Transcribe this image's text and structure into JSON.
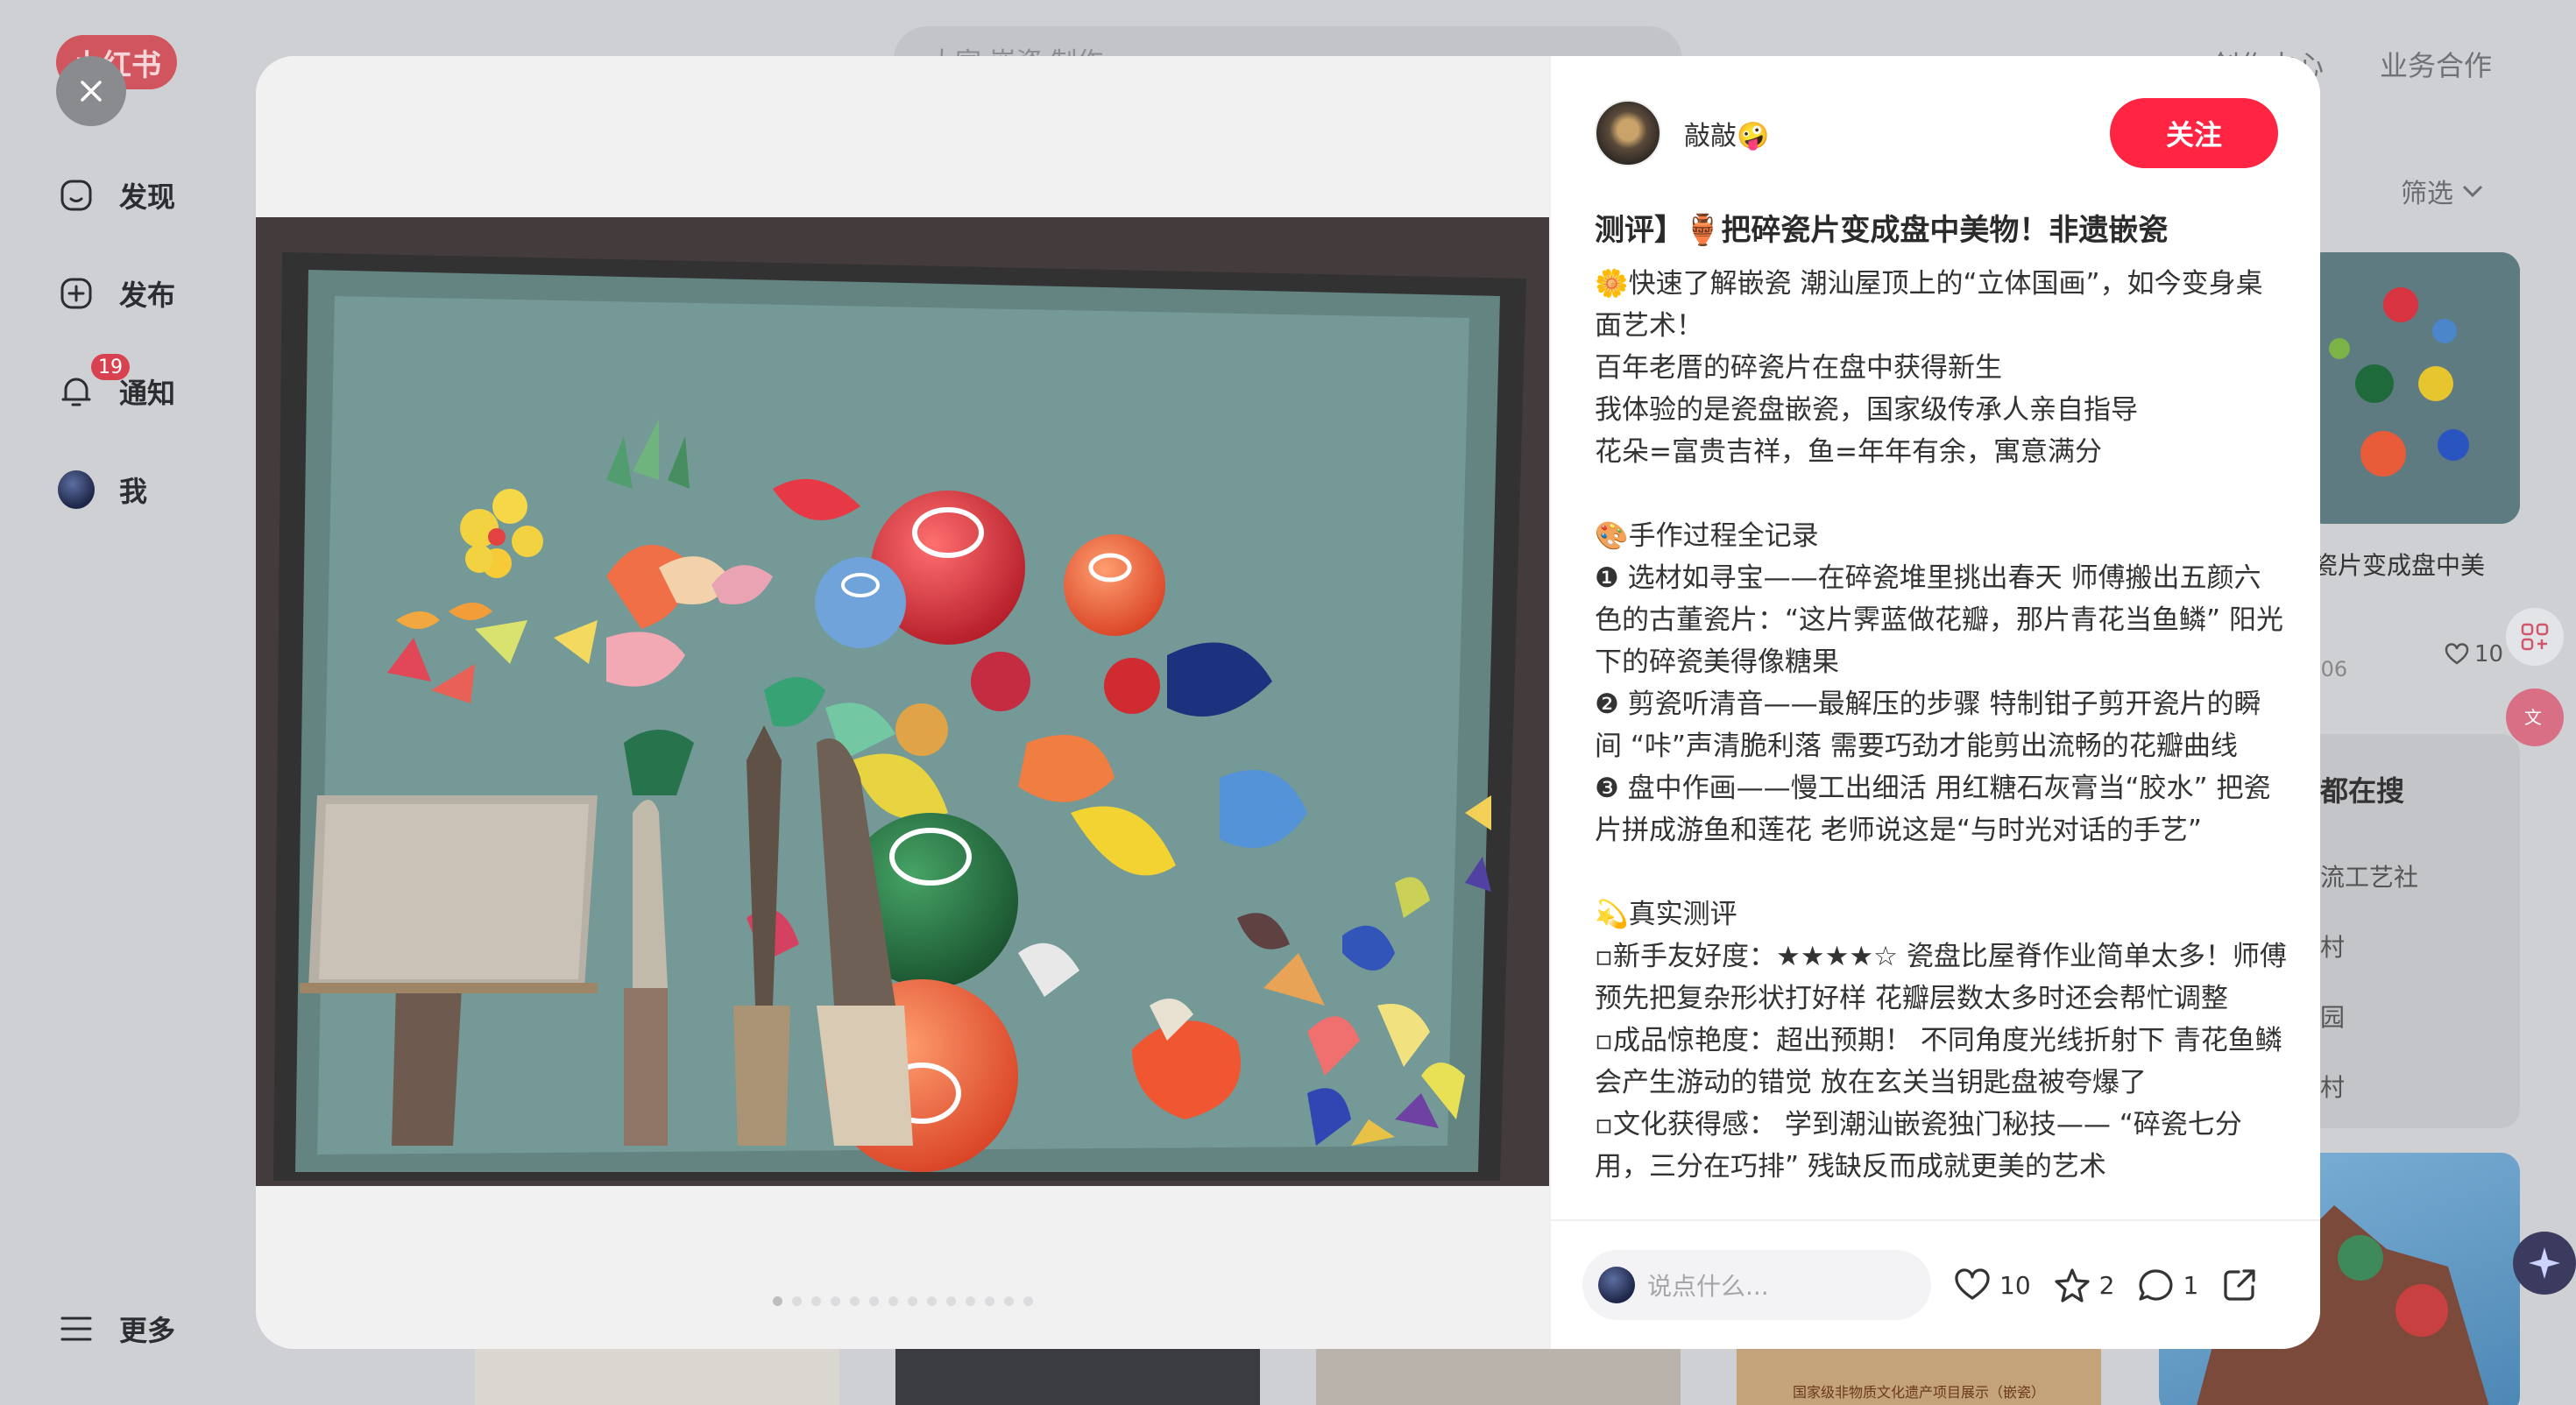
{
  "background": {
    "logo": "小红书",
    "search_text": "大家 嵌瓷 制作",
    "top_links": [
      "创作中心",
      "业务合作"
    ],
    "sidebar": [
      {
        "label": "发现",
        "icon": "home-icon"
      },
      {
        "label": "发布",
        "icon": "plus-square-icon"
      },
      {
        "label": "通知",
        "icon": "bell-icon",
        "badge": "19"
      },
      {
        "label": "我",
        "icon": "user-avatar"
      }
    ],
    "more_label": "更多",
    "filter_label": "筛选",
    "feed_card": {
      "title": "瓷片变成盘中美",
      "title_line2": "!",
      "date": "-06",
      "likes": "10"
    },
    "trending_title": "都在搜",
    "trending_items": [
      "流工艺社",
      "村",
      "园",
      "村"
    ],
    "bottom_banner_text": "国家级非物质文化遗产项目展示（嵌瓷）"
  },
  "modal": {
    "close_icon": "close-icon",
    "image_dots_count": 14,
    "active_dot": 0,
    "author": {
      "name": "敲敲🤪",
      "follow_label": "关注"
    },
    "note": {
      "title": "测评】🏺把碎瓷片变成盘中美物！非遗嵌瓷",
      "paragraphs": [
        [
          "🌼快速了解嵌瓷 潮汕屋顶上的“立体国画”，如今变身桌面艺术！",
          "百年老厝的碎瓷片在盘中获得新生",
          "我体验的是瓷盘嵌瓷，国家级传承人亲自指导",
          "花朵=富贵吉祥，鱼=年年有余，寓意满分"
        ],
        [
          "🎨手作过程全记录",
          "❶ 选材如寻宝——在碎瓷堆里挑出春天 师傅搬出五颜六色的古董瓷片：“这片霁蓝做花瓣，那片青花当鱼鳞” 阳光下的碎瓷美得像糖果",
          "❷ 剪瓷听清音——最解压的步骤 特制钳子剪开瓷片的瞬间 “咔”声清脆利落 需要巧劲才能剪出流畅的花瓣曲线",
          "❸ 盘中作画——慢工出细活 用红糖石灰膏当“胶水” 把瓷片拼成游鱼和莲花 老师说这是“与时光对话的手艺”"
        ],
        [
          "💫真实测评",
          "▫新手友好度：★★★★☆ 瓷盘比屋脊作业简单太多！师傅预先把复杂形状打好样 花瓣层数太多时还会帮忙调整",
          "▫成品惊艳度：超出预期！ 不同角度光线折射下 青花鱼鳞会产生游动的错觉 放在玄关当钥匙盘被夸爆了",
          "▫文化获得感： 学到潮汕嵌瓷独门秘技—— “碎瓷七分用，三分在巧排” 残缺反而成就更美的艺术"
        ]
      ]
    },
    "comment_placeholder": "说点什么...",
    "actions": {
      "likes": "10",
      "collects": "2",
      "comments": "1"
    }
  },
  "colors": {
    "accent": "#ff2442",
    "badge": "#d8414f"
  }
}
